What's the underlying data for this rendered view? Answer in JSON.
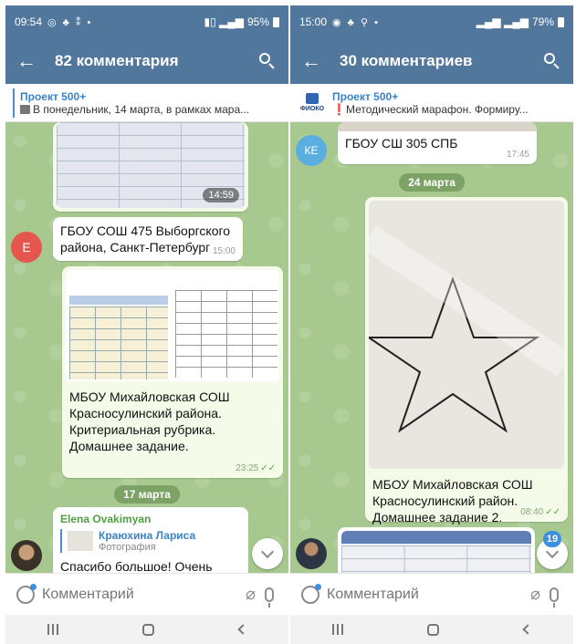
{
  "left": {
    "status": {
      "time": "09:54",
      "battery": "95%"
    },
    "header": {
      "title": "82 комментария"
    },
    "pinned": {
      "title": "Проект 500+",
      "subtitle": "В понедельник, 14 марта, в рамках мара..."
    },
    "messages": {
      "photo_time": "14:59",
      "gbou_avatar": "Е",
      "gbou_text": "ГБОУ СОШ 475 Выборгского района, Санкт-Петербург",
      "gbou_time": "15:00",
      "mboou_text": "МБОУ Михайловская СОШ Красносулинский района. Критериальная рубрика. Домашнее задание.",
      "mboou_time": "23:25",
      "date": "17 марта",
      "reply_sender": "Elena Ovakimyan",
      "reply_name": "Краюхина Лариса",
      "reply_type": "Фотография",
      "reply_text": "Спасибо большое! Очень"
    },
    "input": {
      "placeholder": "Комментарий"
    }
  },
  "right": {
    "status": {
      "time": "15:00",
      "battery": "79%"
    },
    "header": {
      "title": "30 комментариев"
    },
    "pinned": {
      "title": "Проект 500+",
      "subtitle": "Методический марафон. Формиру...",
      "logo": "ФИОКО"
    },
    "messages": {
      "ke_avatar": "КЕ",
      "gbou_text": "ГБОУ СШ 305 СПБ",
      "gbou_time": "17:45",
      "date": "24 марта",
      "mboou_text": "МБОУ Михайловская СОШ Красносулинский район. Домашнее задание 2.",
      "mboou_time": "08:40",
      "unread": "19"
    },
    "input": {
      "placeholder": "Комментарий"
    }
  }
}
